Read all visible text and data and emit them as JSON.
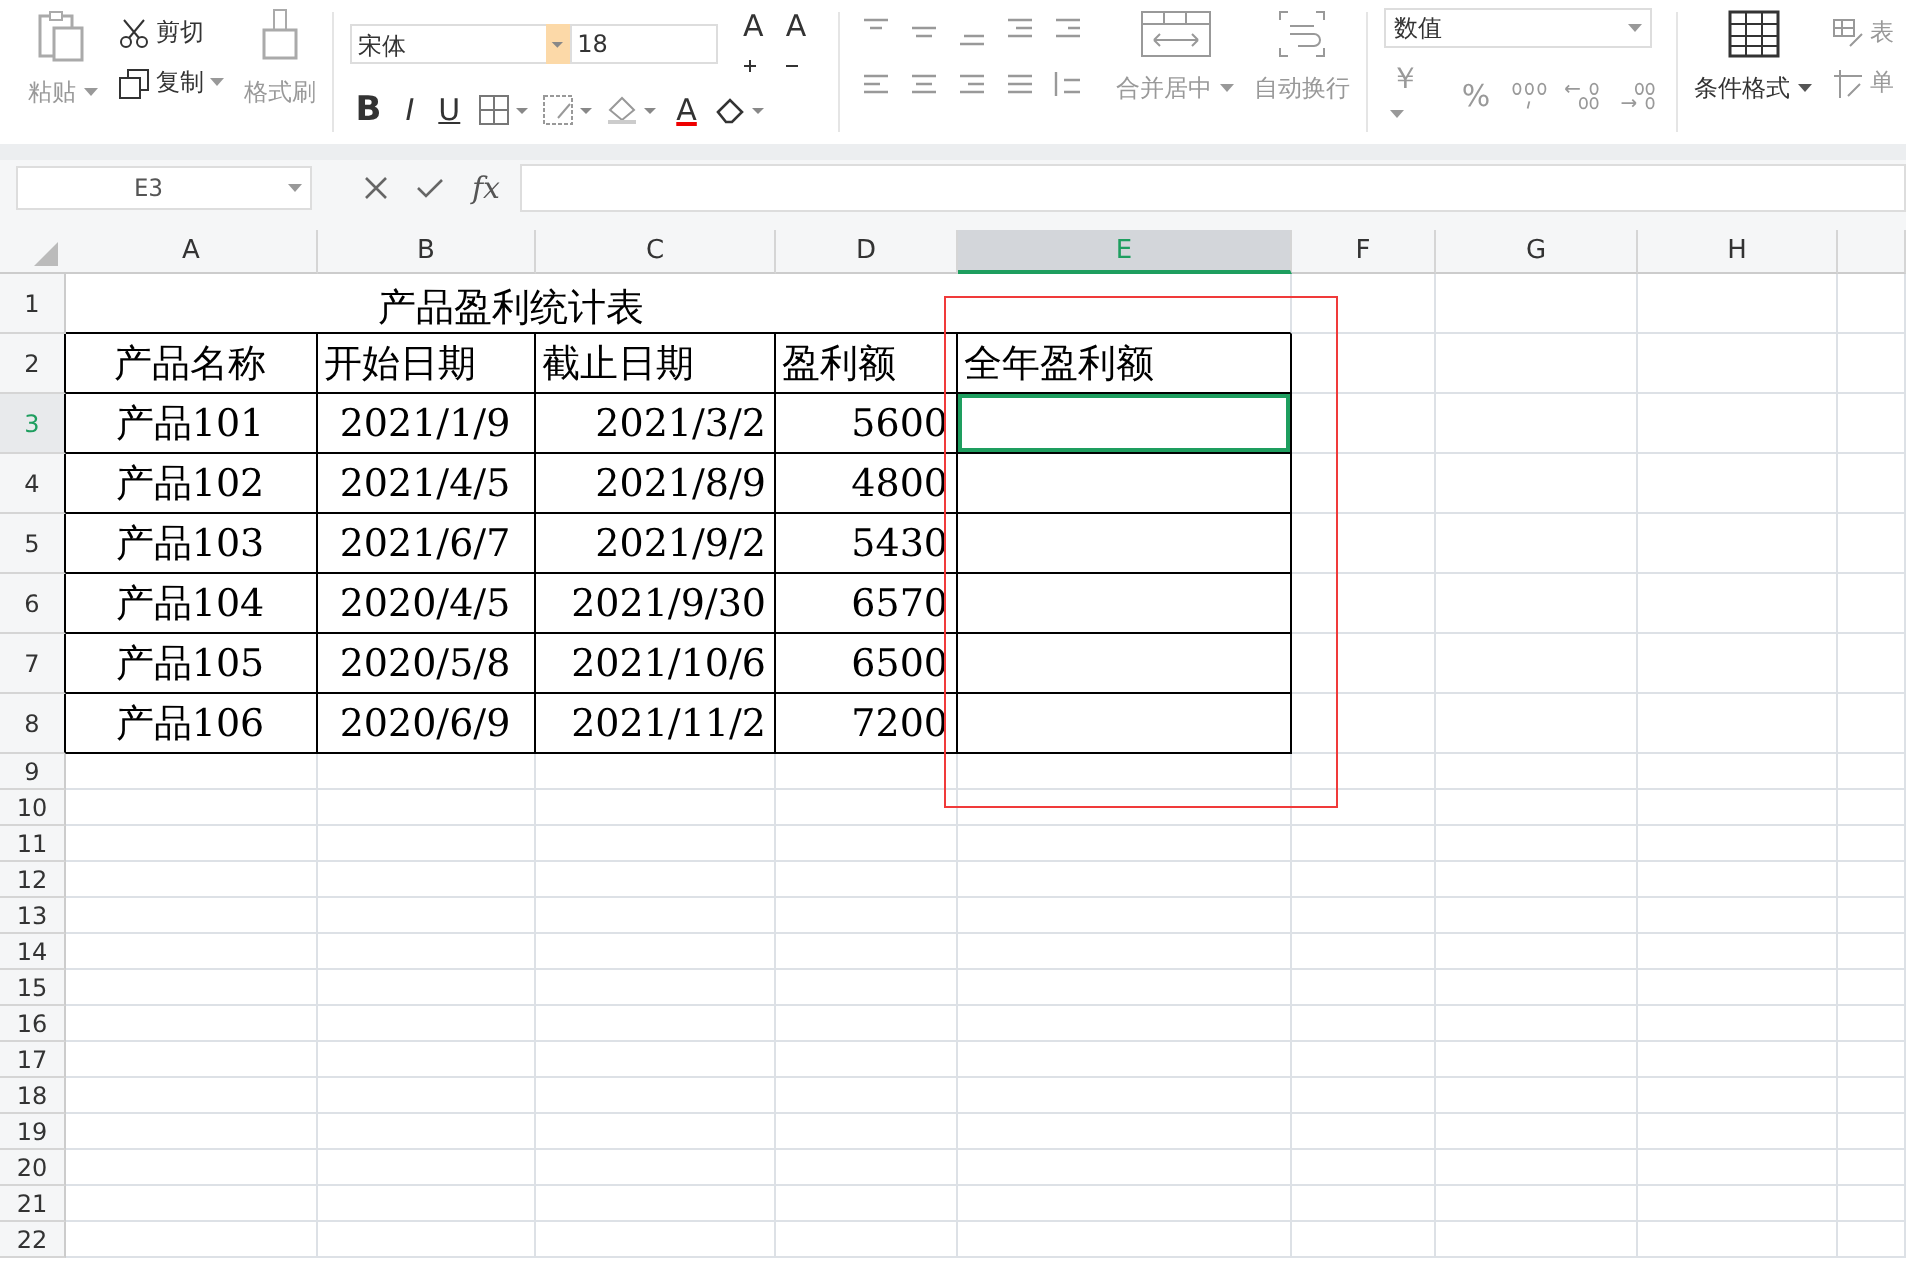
{
  "toolbar": {
    "paste": "粘贴",
    "cut": "剪切",
    "copy": "复制",
    "format_painter": "格式刷",
    "font_name": "宋体",
    "font_size": "18",
    "grow_font": "A",
    "shrink_font": "A",
    "bold": "B",
    "italic": "I",
    "underline": "U",
    "font_color": "A",
    "merge_center": "合并居中",
    "wrap_text": "自动换行",
    "number_format": "数值",
    "currency": "￥",
    "percent": "%",
    "conditional_format": "条件格式",
    "table_style": "表",
    "cell_style": "单"
  },
  "formula_bar": {
    "name_box": "E3",
    "fx": "fx"
  },
  "columns": [
    {
      "label": "A",
      "selected": false
    },
    {
      "label": "B",
      "selected": false
    },
    {
      "label": "C",
      "selected": false
    },
    {
      "label": "D",
      "selected": false
    },
    {
      "label": "E",
      "selected": true
    },
    {
      "label": "F",
      "selected": false
    },
    {
      "label": "G",
      "selected": false
    },
    {
      "label": "H",
      "selected": false
    }
  ],
  "rows": [
    {
      "label": "1",
      "selected": false
    },
    {
      "label": "2",
      "selected": false
    },
    {
      "label": "3",
      "selected": true
    },
    {
      "label": "4",
      "selected": false
    },
    {
      "label": "5",
      "selected": false
    },
    {
      "label": "6",
      "selected": false
    },
    {
      "label": "7",
      "selected": false
    },
    {
      "label": "8",
      "selected": false
    },
    {
      "label": "9",
      "selected": false
    },
    {
      "label": "10",
      "selected": false
    },
    {
      "label": "11",
      "selected": false
    },
    {
      "label": "12",
      "selected": false
    },
    {
      "label": "13",
      "selected": false
    },
    {
      "label": "14",
      "selected": false
    },
    {
      "label": "15",
      "selected": false
    },
    {
      "label": "16",
      "selected": false
    },
    {
      "label": "17",
      "selected": false
    },
    {
      "label": "18",
      "selected": false
    },
    {
      "label": "19",
      "selected": false
    },
    {
      "label": "20",
      "selected": false
    },
    {
      "label": "21",
      "selected": false
    },
    {
      "label": "22",
      "selected": false
    }
  ],
  "sheet": {
    "title": "产品盈利统计表",
    "header": [
      "产品名称",
      "开始日期",
      "截止日期",
      "盈利额",
      "全年盈利额"
    ],
    "records": [
      [
        "产品101",
        "2021/1/9",
        "2021/3/2",
        "5600"
      ],
      [
        "产品102",
        "2021/4/5",
        "2021/8/9",
        "4800"
      ],
      [
        "产品103",
        "2021/6/7",
        "2021/9/2",
        "5430"
      ],
      [
        "产品104",
        "2020/4/5",
        "2021/9/30",
        "6570"
      ],
      [
        "产品105",
        "2020/5/8",
        "2021/10/6",
        "6500"
      ],
      [
        "产品106",
        "2020/6/9",
        "2021/11/2",
        "7200"
      ]
    ]
  }
}
